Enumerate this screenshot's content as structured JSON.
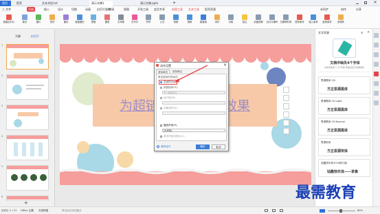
{
  "tabs": [
    "首页",
    "稻壳",
    "文本文档.txt",
    "演示文稿1",
    "演示文稿.pptx"
  ],
  "menu": [
    "三 文件",
    "开始",
    "插入",
    "设计",
    "切换",
    "动画",
    "幻灯片放映",
    "审阅",
    "视图",
    "开发工具",
    "会员专享",
    "绘图工具",
    "文本工具",
    "稻壳资源"
  ],
  "top_right": [
    "未同步",
    "协作",
    "分享"
  ],
  "ribbon": [
    "新建幻灯片",
    "版式",
    "图片",
    "形状",
    "图标",
    "智能图形",
    "表格",
    "图表",
    "文本框",
    "艺术字",
    "符号",
    "公式",
    "音频",
    "视频",
    "超链接",
    "动作",
    "对象",
    "批注",
    "页眉页脚",
    "幻灯片编号",
    "日期和时间",
    "更多素材",
    "插入素材",
    "稻壳素材",
    "资源夹"
  ],
  "leftpane": {
    "tab1": "大纲",
    "tab2": "幻灯片",
    "add": "+"
  },
  "slide": {
    "title": "为超链接添加动作效果"
  },
  "dialog": {
    "title": "动作设置",
    "tab1": "鼠标单击",
    "tab2": "鼠标移过",
    "group_label": "单击鼠标时的动作",
    "opt_none": "无动作(N)",
    "opt_link": "超链接到(H):",
    "link_value": "下一张幻灯片",
    "opt_macro": "运行宏(M):",
    "opt_object": "对象动作(A):",
    "chk_sound": "播放声音(P):",
    "sound_value": "[无声音]",
    "chk_highlight": "单击时突出显示(C)",
    "help": "操作技巧",
    "ok": "确定",
    "cancel": "取消"
  },
  "rightpane": {
    "header": "文字资源",
    "promo_line1": "文档中缺失4个字体",
    "promo_line2": "文档中使用了以下字体,安装后显示效果更佳",
    "fonts": [
      {
        "name": "思源黑体 CN",
        "sample": "方正思源黑体"
      },
      {
        "name": "思源黑体 CN Light",
        "sample": "方正思源黑体"
      },
      {
        "name": "思源黑体 CN Normal",
        "sample": "方正思源黑体"
      },
      {
        "name": "思源宋体",
        "sample": "方正思源宋体"
      },
      {
        "name": "站酷快乐体2016修订版",
        "sample": "站酷快乐体——享像"
      }
    ]
  },
  "status": {
    "slide_info": "幻灯片 1 / 21",
    "theme": "Office 主题",
    "fix": "文档修复",
    "notes_hint": "单击此处添加备注",
    "zoom": "80%"
  },
  "watermark": "最需教育",
  "colors": {
    "accent": "#2f6fd6",
    "scallop": "#f59e9c",
    "highlight": "#e3454a",
    "banner": "#f8c9a8"
  }
}
